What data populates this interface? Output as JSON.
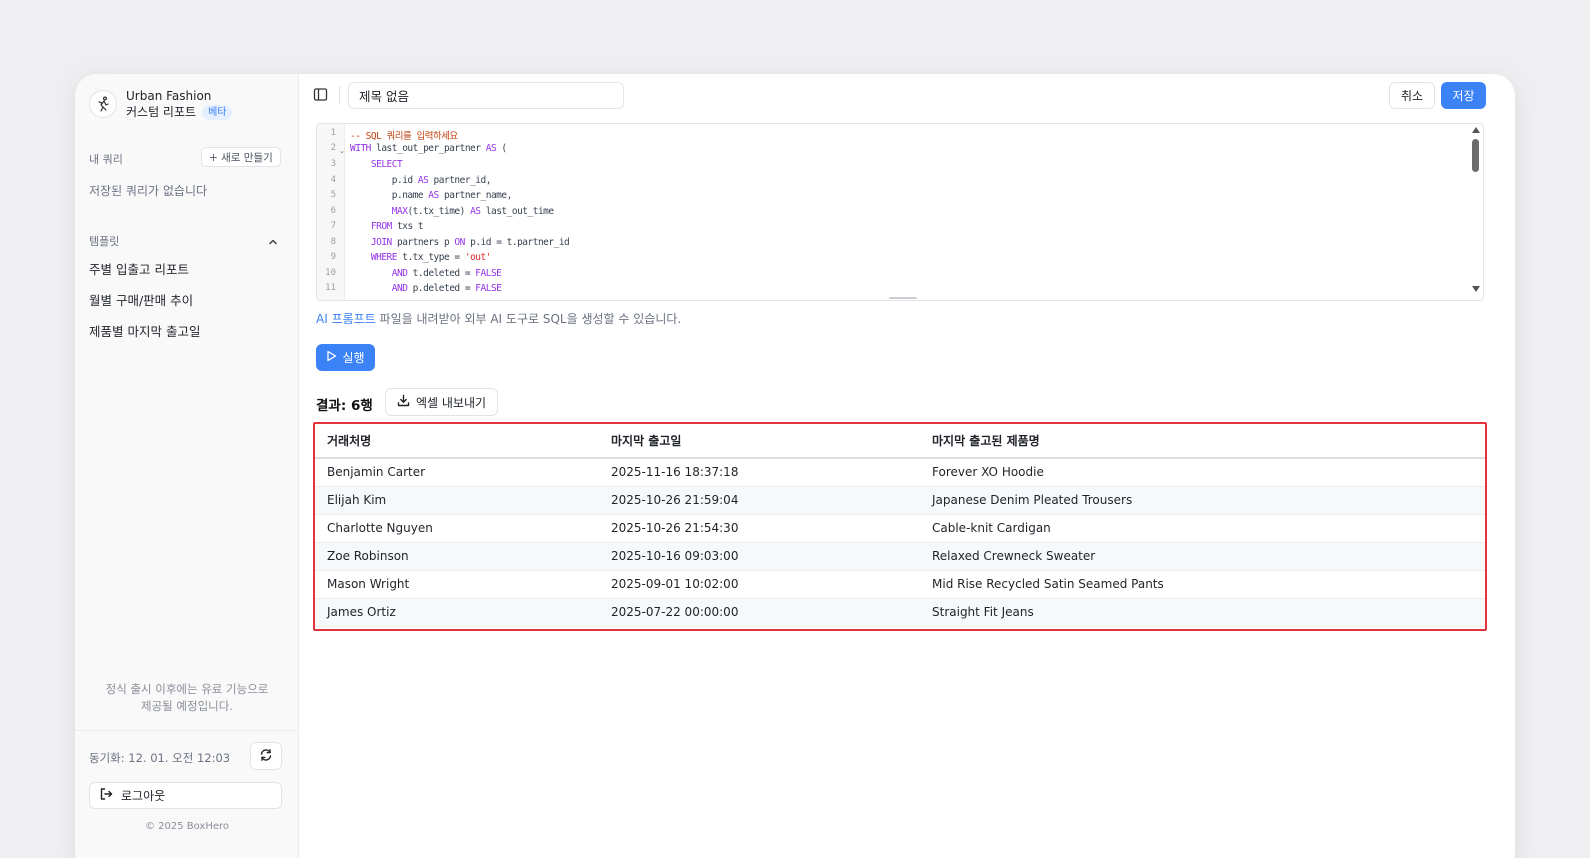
{
  "brand": {
    "name": "Urban Fashion",
    "subtitle": "커스텀 리포트",
    "badge": "베타"
  },
  "sidebar": {
    "my_queries_label": "내 쿼리",
    "new_button": "+ 새로 만들기",
    "empty_text": "저장된 쿼리가 없습니다",
    "templates_label": "템플릿",
    "templates": [
      {
        "label": "주별 입출고 리포트"
      },
      {
        "label": "월별 구매/판매 추이"
      },
      {
        "label": "제품별 마지막 출고일"
      }
    ],
    "notice_line1": "정식 출시 이후에는 유료 기능으로",
    "notice_line2": "제공될 예정입니다.",
    "sync_text": "동기화: 12. 01. 오전 12:03",
    "logout_label": "로그아웃",
    "copyright": "© 2025 BoxHero"
  },
  "toolbar": {
    "title_value": "제목 없음",
    "cancel_label": "취소",
    "save_label": "저장"
  },
  "editor": {
    "line_numbers": [
      "1",
      "2",
      "3",
      "4",
      "5",
      "6",
      "7",
      "8",
      "9",
      "10",
      "11"
    ]
  },
  "prompt": {
    "link": "AI 프롬프트",
    "text": " 파일을 내려받아 외부 AI 도구로 SQL을 생성할 수 있습니다."
  },
  "run_label": "실행",
  "results": {
    "count_label": "결과: 6행",
    "export_label": "엑셀 내보내기",
    "columns": [
      "거래처명",
      "마지막 출고일",
      "마지막 출고된 제품명"
    ],
    "rows": [
      [
        "Benjamin Carter",
        "2025-11-16 18:37:18",
        "Forever XO Hoodie"
      ],
      [
        "Elijah Kim",
        "2025-10-26 21:59:04",
        "Japanese Denim Pleated Trousers"
      ],
      [
        "Charlotte Nguyen",
        "2025-10-26 21:54:30",
        "Cable-knit Cardigan"
      ],
      [
        "Zoe Robinson",
        "2025-10-16 09:03:00",
        "Relaxed Crewneck Sweater"
      ],
      [
        "Mason Wright",
        "2025-09-01 10:02:00",
        "Mid Rise Recycled Satin Seamed Pants"
      ],
      [
        "James Ortiz",
        "2025-07-22 00:00:00",
        "Straight Fit Jeans"
      ]
    ]
  },
  "colors": {
    "accent": "#3b82f6",
    "highlight_border": "#e3343b"
  }
}
